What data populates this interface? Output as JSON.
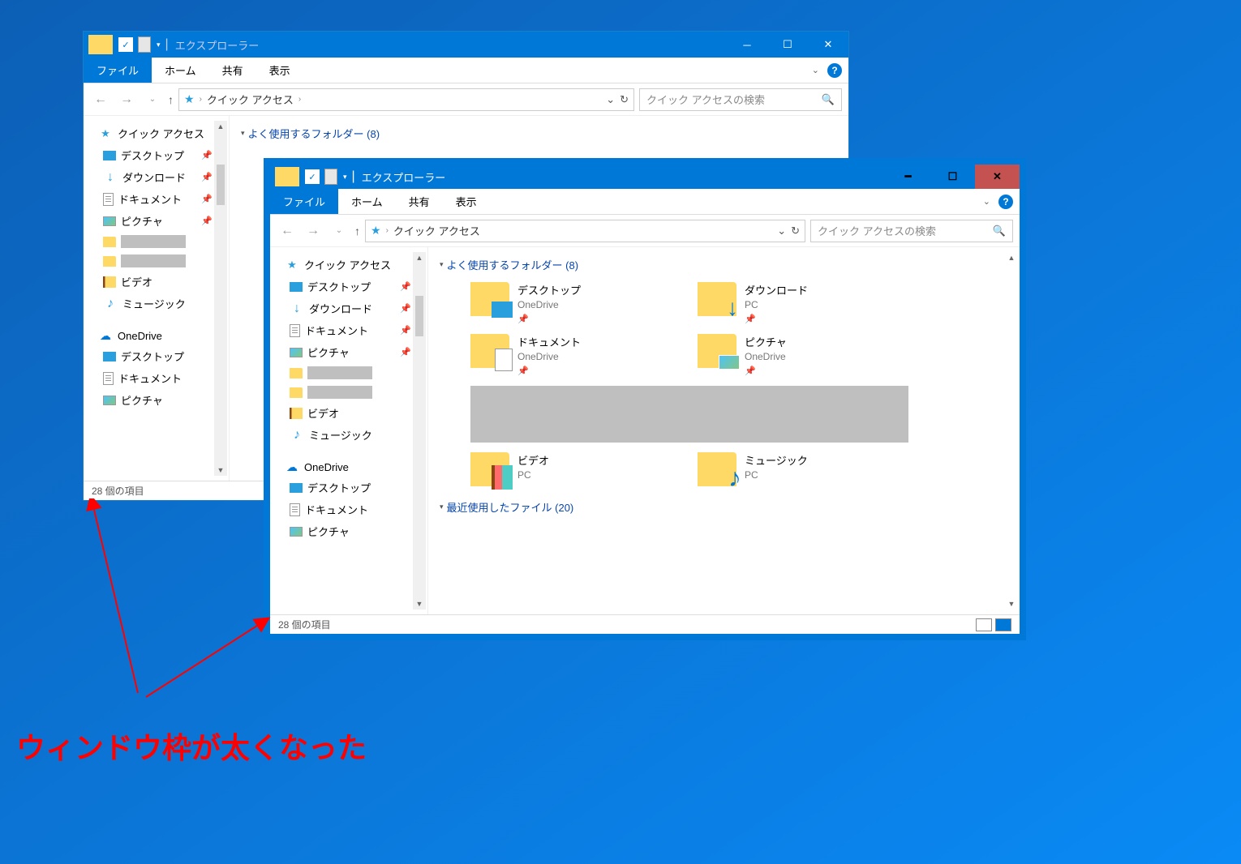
{
  "annotation": "ウィンドウ枠が太くなった",
  "window_back": {
    "title": "エクスプローラー",
    "tabs": {
      "file": "ファイル",
      "home": "ホーム",
      "share": "共有",
      "view": "表示"
    },
    "breadcrumb": "クイック アクセス",
    "search_placeholder": "クイック アクセスの検索",
    "group_header": "よく使用するフォルダー (8)",
    "nav": {
      "quick_access": "クイック アクセス",
      "items": [
        "デスクトップ",
        "ダウンロード",
        "ドキュメント",
        "ピクチャ"
      ],
      "video": "ビデオ",
      "music": "ミュージック",
      "onedrive": "OneDrive",
      "od_items": [
        "デスクトップ",
        "ドキュメント",
        "ピクチャ"
      ]
    },
    "status": "28 個の項目"
  },
  "window_front": {
    "title": "エクスプローラー",
    "tabs": {
      "file": "ファイル",
      "home": "ホーム",
      "share": "共有",
      "view": "表示"
    },
    "breadcrumb": "クイック アクセス",
    "search_placeholder": "クイック アクセスの検索",
    "group_header": "よく使用するフォルダー (8)",
    "nav": {
      "quick_access": "クイック アクセス",
      "items": [
        "デスクトップ",
        "ダウンロード",
        "ドキュメント",
        "ピクチャ"
      ],
      "video": "ビデオ",
      "music": "ミュージック",
      "onedrive": "OneDrive",
      "od_items": [
        "デスクトップ",
        "ドキュメント",
        "ピクチャ"
      ]
    },
    "folders": [
      {
        "name": "デスクトップ",
        "sub": "OneDrive"
      },
      {
        "name": "ダウンロード",
        "sub": "PC"
      },
      {
        "name": "ドキュメント",
        "sub": "OneDrive"
      },
      {
        "name": "ピクチャ",
        "sub": "OneDrive"
      },
      {
        "name": "ビデオ",
        "sub": "PC"
      },
      {
        "name": "ミュージック",
        "sub": "PC"
      }
    ],
    "recent_header": "最近使用したファイル (20)",
    "status": "28 個の項目"
  }
}
